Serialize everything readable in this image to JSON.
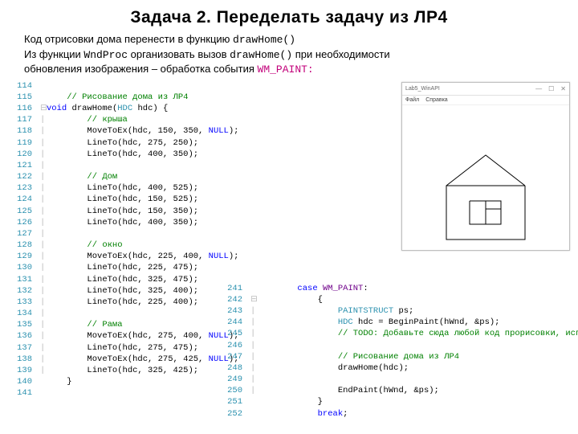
{
  "title": "Задача 2. Переделать задачу из  ЛР4",
  "desc": {
    "l1a": "Код отрисовки дома перенести в функцию ",
    "l1b": "drawHome()",
    "l2a": "Из функции ",
    "l2b": "WndProc",
    "l2c": "  организовать  вызов  ",
    "l2d": "drawHome()",
    "l2e": " при необходимости",
    "l3a": "обновления изображения – обработка события ",
    "l3b": "WM_PAINT:"
  },
  "left_code": [
    {
      "n": "114",
      "g": " ",
      "html": ""
    },
    {
      "n": "115",
      "g": " ",
      "html": "    <span class=\"cmt\">// Рисование дома из ЛР4</span>"
    },
    {
      "n": "116",
      "g": "⊟",
      "html": "<span class=\"kw-blue\">void</span> <span class=\"plain\">drawHome(</span><span class=\"type\">HDC</span> <span class=\"plain\">hdc) {</span>"
    },
    {
      "n": "117",
      "g": "|",
      "html": "        <span class=\"cmt\">// крыша</span>"
    },
    {
      "n": "118",
      "g": "|",
      "html": "        <span class=\"plain\">MoveToEx(hdc, 150, 350, </span><span class=\"kw-null\">NULL</span><span class=\"plain\">);</span>"
    },
    {
      "n": "119",
      "g": "|",
      "html": "        <span class=\"plain\">LineTo(hdc, 275, 250);</span>"
    },
    {
      "n": "120",
      "g": "|",
      "html": "        <span class=\"plain\">LineTo(hdc, 400, 350);</span>"
    },
    {
      "n": "121",
      "g": "|",
      "html": ""
    },
    {
      "n": "122",
      "g": "|",
      "html": "        <span class=\"cmt\">// Дом</span>"
    },
    {
      "n": "123",
      "g": "|",
      "html": "        <span class=\"plain\">LineTo(hdc, 400, 525);</span>"
    },
    {
      "n": "124",
      "g": "|",
      "html": "        <span class=\"plain\">LineTo(hdc, 150, 525);</span>"
    },
    {
      "n": "125",
      "g": "|",
      "html": "        <span class=\"plain\">LineTo(hdc, 150, 350);</span>"
    },
    {
      "n": "126",
      "g": "|",
      "html": "        <span class=\"plain\">LineTo(hdc, 400, 350);</span>"
    },
    {
      "n": "127",
      "g": "|",
      "html": ""
    },
    {
      "n": "128",
      "g": "|",
      "html": "        <span class=\"cmt\">// окно</span>"
    },
    {
      "n": "129",
      "g": "|",
      "html": "        <span class=\"plain\">MoveToEx(hdc, 225, 400, </span><span class=\"kw-null\">NULL</span><span class=\"plain\">);</span>"
    },
    {
      "n": "130",
      "g": "|",
      "html": "        <span class=\"plain\">LineTo(hdc, 225, 475);</span>"
    },
    {
      "n": "131",
      "g": "|",
      "html": "        <span class=\"plain\">LineTo(hdc, 325, 475);</span>"
    },
    {
      "n": "132",
      "g": "|",
      "html": "        <span class=\"plain\">LineTo(hdc, 325, 400);</span>"
    },
    {
      "n": "133",
      "g": "|",
      "html": "        <span class=\"plain\">LineTo(hdc, 225, 400);</span>"
    },
    {
      "n": "134",
      "g": "|",
      "html": ""
    },
    {
      "n": "135",
      "g": "|",
      "html": "        <span class=\"cmt\">// Рама</span>"
    },
    {
      "n": "136",
      "g": "|",
      "html": "        <span class=\"plain\">MoveToEx(hdc, 275, 400, </span><span class=\"kw-null\">NULL</span><span class=\"plain\">);</span>"
    },
    {
      "n": "137",
      "g": "|",
      "html": "        <span class=\"plain\">LineTo(hdc, 275, 475);</span>"
    },
    {
      "n": "138",
      "g": "|",
      "html": "        <span class=\"plain\">MoveToEx(hdc, 275, 425, </span><span class=\"kw-null\">NULL</span><span class=\"plain\">);</span>"
    },
    {
      "n": "139",
      "g": "|",
      "html": "        <span class=\"plain\">LineTo(hdc, 325, 425);</span>"
    },
    {
      "n": "140",
      "g": " ",
      "html": "    <span class=\"plain\">}</span>"
    },
    {
      "n": "141",
      "g": " ",
      "html": ""
    }
  ],
  "right_code": [
    {
      "n": "241",
      "g": " ",
      "html": "        <span class=\"kw-blue\">case</span> <span class=\"purple\">WM_PAINT</span><span class=\"plain\">:</span>"
    },
    {
      "n": "242",
      "g": "⊟",
      "html": "            <span class=\"plain\">{</span>"
    },
    {
      "n": "243",
      "g": "|",
      "html": "                <span class=\"type\">PAINTSTRUCT</span> <span class=\"plain\">ps;</span>"
    },
    {
      "n": "244",
      "g": "|",
      "html": "                <span class=\"type\">HDC</span> <span class=\"plain\">hdc = BeginPaint(hWnd, &amp;ps);</span>"
    },
    {
      "n": "245",
      "g": "|",
      "html": "                <span class=\"cmt\">// TODO: Добавьте сюда любой код прорисовки, использующий HDC...</span>"
    },
    {
      "n": "246",
      "g": "|",
      "html": ""
    },
    {
      "n": "247",
      "g": "|",
      "html": "                <span class=\"cmt\">// Рисование дома из ЛР4</span>"
    },
    {
      "n": "248",
      "g": "|",
      "html": "                <span class=\"plain\">drawHome(hdc);</span>"
    },
    {
      "n": "249",
      "g": "|",
      "html": ""
    },
    {
      "n": "250",
      "g": "|",
      "html": "                <span class=\"plain\">EndPaint(hWnd, &amp;ps);</span>"
    },
    {
      "n": "251",
      "g": " ",
      "html": "            <span class=\"plain\">}</span>"
    },
    {
      "n": "252",
      "g": " ",
      "html": "            <span class=\"kw-blue\">break</span><span class=\"plain\">;</span>"
    }
  ],
  "win": {
    "title": "Lab5_WinAPI",
    "menu1": "Файл",
    "menu2": "Справка",
    "minimize": "—",
    "maximize": "☐",
    "close": "✕"
  }
}
